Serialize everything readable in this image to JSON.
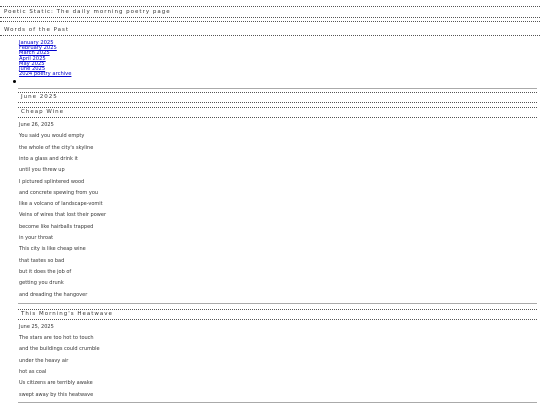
{
  "site_title": "Poetic Static: The daily morning poetry page",
  "sidebar_heading": "Words of the Past",
  "archive_links": [
    "January 2025",
    "February 2025",
    "March 2025",
    "April 2025",
    "May 2025",
    "June 2025"
  ],
  "archive_2024_link": "2024 poetry archive",
  "month_heading": "June 2025",
  "posts": [
    {
      "title": "Cheap Wine",
      "date": "June 26, 2025",
      "lines": [
        "You said you would empty",
        "the whole of the city's skyline",
        "into a glass and drink it",
        "until you threw up",
        "I pictured splintered wood",
        "and concrete spewing from you",
        "like a volcano of landscape-vomit",
        "Veins of wires that lost their power",
        "become like hairballs trapped",
        "in your throat",
        "This city is like cheap wine",
        "that tastes so bad",
        "but it does the job of",
        "getting you drunk",
        "and dreading the hangover"
      ]
    },
    {
      "title": "This Morning's Heatwave",
      "date": "June 25, 2025",
      "lines": [
        "The stars are too hot to touch",
        "and the buildings could crumble",
        "under the heavy air",
        "hot as coal",
        "Us citizens are terribly awake",
        "swept away by this heatwave"
      ]
    }
  ]
}
